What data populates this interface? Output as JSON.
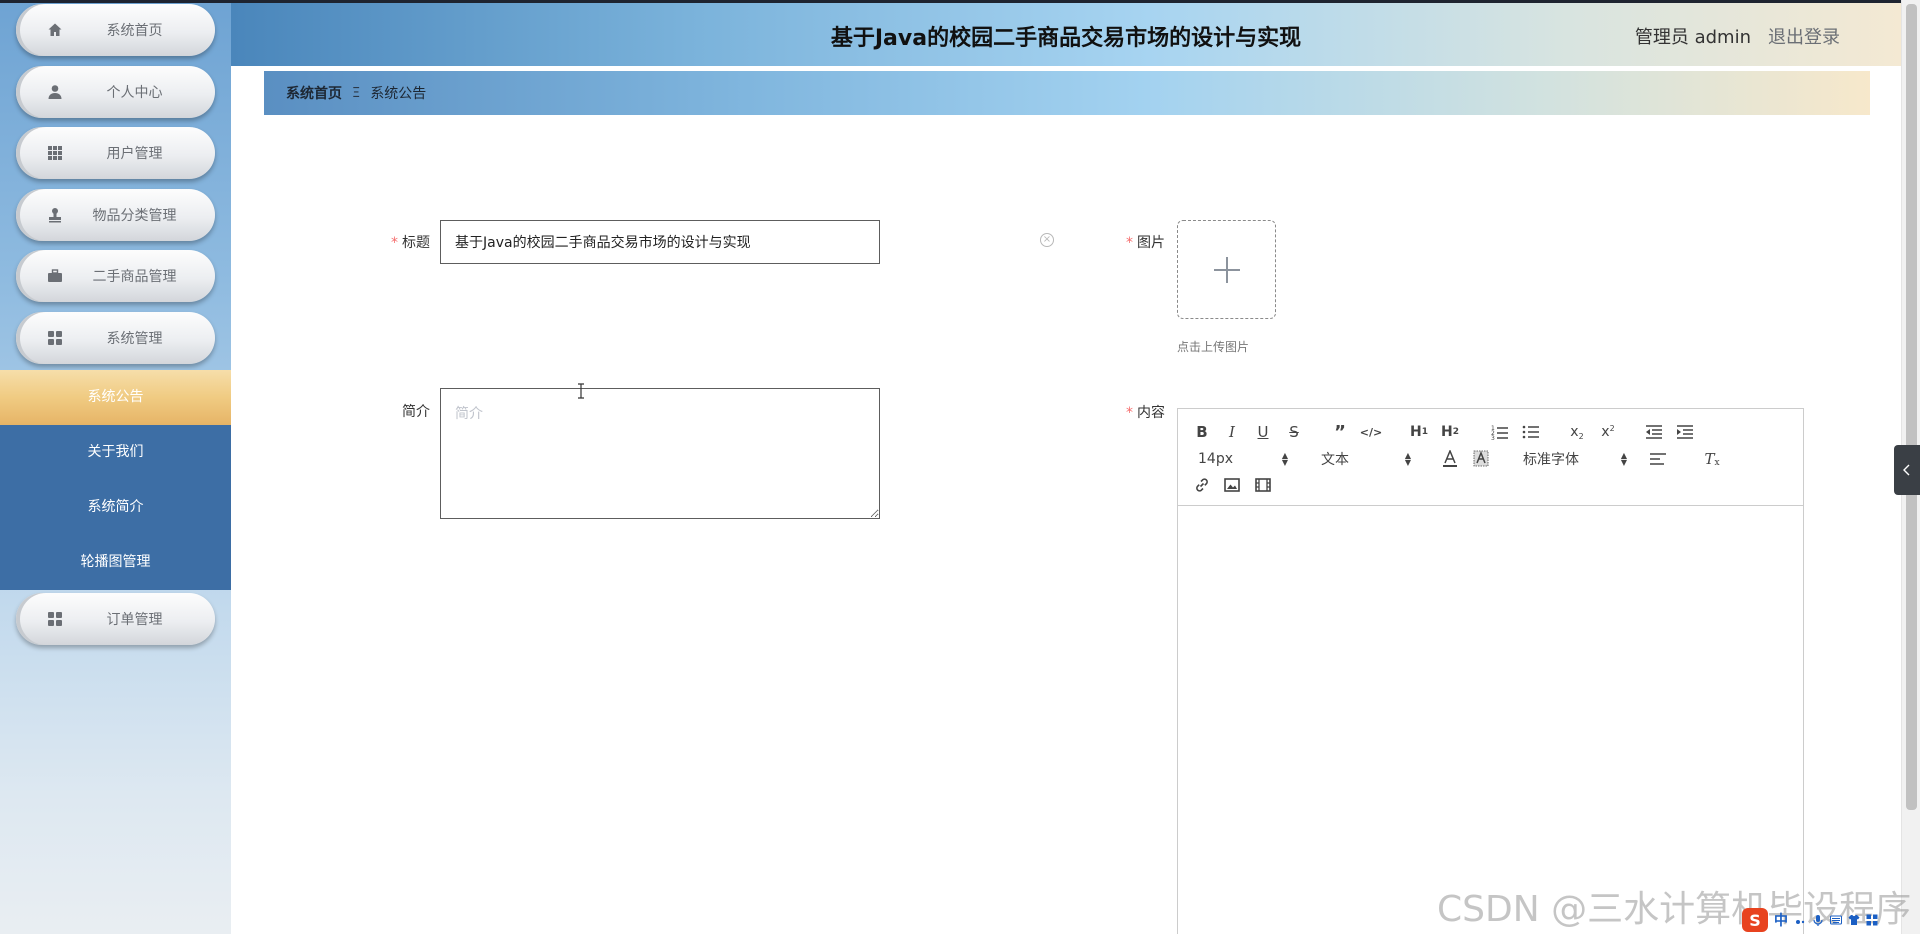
{
  "app_title": "基于Java的校园二手商品交易市场的设计与实现",
  "header": {
    "admin_label": "管理员 admin",
    "logout_label": "退出登录"
  },
  "sidebar": {
    "items": [
      {
        "label": "系统首页",
        "icon": "home-icon"
      },
      {
        "label": "个人中心",
        "icon": "user-icon"
      },
      {
        "label": "用户管理",
        "icon": "grid-icon"
      },
      {
        "label": "物品分类管理",
        "icon": "stamp-icon"
      },
      {
        "label": "二手商品管理",
        "icon": "briefcase-icon"
      },
      {
        "label": "系统管理",
        "icon": "apps-icon"
      }
    ],
    "sub_items": [
      {
        "label": "系统公告",
        "active": true
      },
      {
        "label": "关于我们",
        "active": false
      },
      {
        "label": "系统简介",
        "active": false
      },
      {
        "label": "轮播图管理",
        "active": false
      }
    ],
    "order_item": {
      "label": "订单管理",
      "icon": "apps-icon"
    }
  },
  "breadcrumb": {
    "home": "系统首页",
    "separator": "Ξ",
    "current": "系统公告"
  },
  "form": {
    "title_label": "标题",
    "title_value": "基于Java的校园二手商品交易市场的设计与实现",
    "summary_label": "简介",
    "summary_placeholder": "简介",
    "image_label": "图片",
    "upload_tip": "点击上传图片",
    "content_label": "内容"
  },
  "editor": {
    "font_size": "14px",
    "paragraph_format": "文本",
    "font_family": "标准字体",
    "buttons": [
      "bold",
      "italic",
      "underline",
      "strike",
      "blockquote",
      "code-block",
      "header-1",
      "header-2",
      "ordered-list",
      "bullet-list",
      "subscript",
      "superscript",
      "outdent",
      "indent",
      "font-color",
      "background-color",
      "align",
      "clean",
      "link",
      "image",
      "video"
    ]
  },
  "watermark": "CSDN @三水计算机毕设程序",
  "ime": {
    "mode": "中"
  },
  "colors": {
    "accent_blue": "#3d6ea5",
    "active_gold": "#f0cb82",
    "required_red": "#f56c6c"
  }
}
